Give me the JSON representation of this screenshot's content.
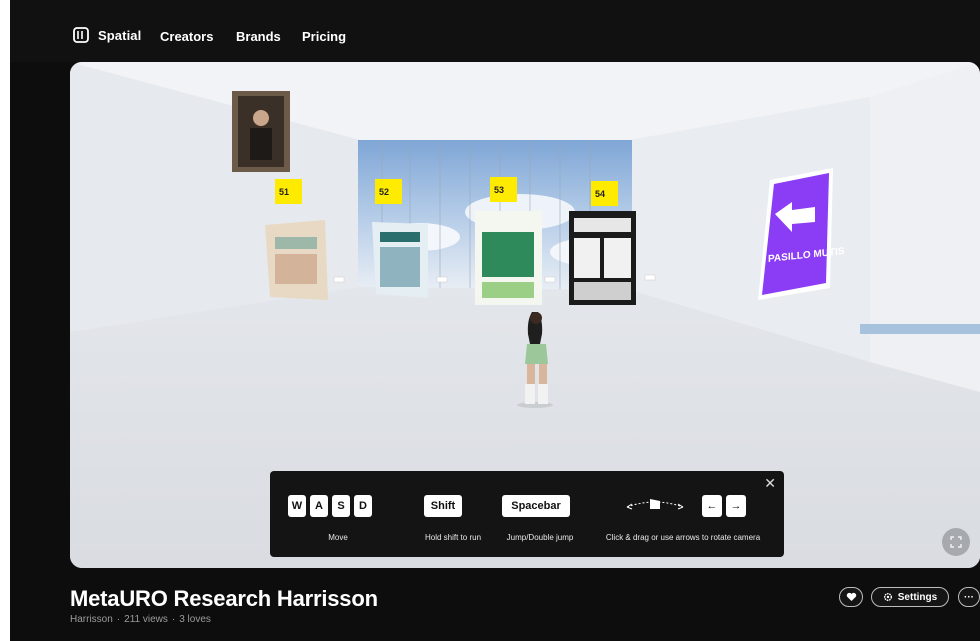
{
  "nav": {
    "brand": "Spatial",
    "links": [
      "Creators",
      "Brands",
      "Pricing"
    ]
  },
  "scene": {
    "tags": [
      "51",
      "52",
      "53",
      "54"
    ],
    "sign_text": "PASILLO MUTIS"
  },
  "controls": {
    "keys_move": [
      "W",
      "A",
      "S",
      "D"
    ],
    "key_shift": "Shift",
    "key_space": "Spacebar",
    "arrow_left": "←",
    "arrow_right": "→",
    "labels": {
      "move": "Move",
      "run": "Hold shift to run",
      "jump": "Jump/Double jump",
      "camera": "Click & drag or use arrows to rotate camera"
    },
    "close": "✕"
  },
  "space": {
    "title": "MetaURO Research Harrisson",
    "creator": "Harrisson",
    "views": "211 views",
    "loves": "3 loves"
  },
  "actions": {
    "settings_label": "Settings",
    "more_label": "···"
  },
  "colors": {
    "accent_sign": "#8b3cf5",
    "tag_yellow": "#ffeb00"
  }
}
